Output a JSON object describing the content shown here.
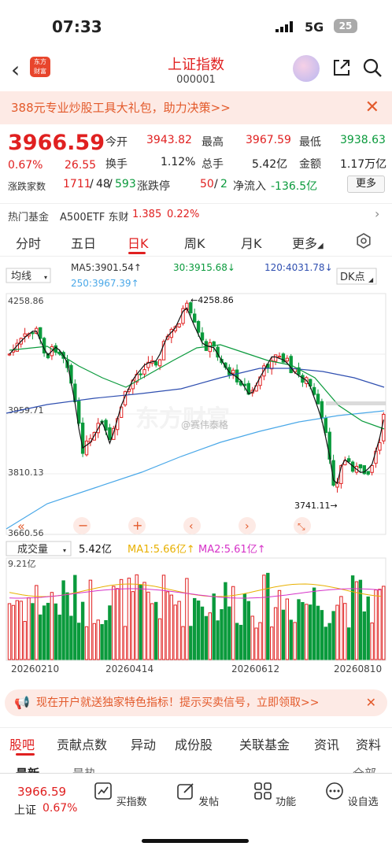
{
  "status": {
    "time": "07:33",
    "network": "5G",
    "battery": "25"
  },
  "header": {
    "title": "上证指数",
    "code": "000001",
    "logo_text": "东方财富"
  },
  "banner": {
    "text": "388元专业炒股工具大礼包，助力决策>>"
  },
  "quote": {
    "price": "3966.59",
    "change_pct": "0.67%",
    "change": "26.55",
    "open_label": "今开",
    "open": "3943.82",
    "high_label": "最高",
    "high": "3967.59",
    "low_label": "最低",
    "low": "3938.63",
    "turnover_label": "换手",
    "turnover": "1.12%",
    "volume_label": "总手",
    "volume": "5.42亿",
    "amount_label": "金额",
    "amount": "1.17万亿",
    "breadth_label": "涨跌家数",
    "up": "1711",
    "flat": "48",
    "down": "593",
    "limit_label": "涨跌停",
    "limit_up": "50",
    "limit_down": "2",
    "inflow_label": "净流入",
    "inflow": "-136.5亿",
    "more": "更多"
  },
  "fund": {
    "label": "热门基金",
    "name": "A500ETF 东财",
    "price": "1.385",
    "pct": "0.22%"
  },
  "tabs": [
    "分时",
    "五日",
    "日K",
    "周K",
    "月K",
    "更多"
  ],
  "chart": {
    "ma_select": "均线",
    "ma5": "MA5:3901.54↑",
    "ma30": "30:3915.68↓",
    "ma120": "120:4031.78↓",
    "ma250": "250:3967.39↑",
    "dk": "DK点",
    "y_high": "4258.86",
    "y_mid": "3959.71",
    "y_low2": "3810.13",
    "y_low": "3660.56",
    "marker_high": "4258.86",
    "marker_low": "3741.11",
    "vol_select": "成交量",
    "vol_value": "5.42亿",
    "vol_ma1": "MA1:5.66亿↑",
    "vol_ma2": "MA2:5.61亿↑",
    "vol_max": "9.21亿",
    "dates": [
      "20260210",
      "20260414",
      "20260612",
      "20260810"
    ],
    "watermark": "东方财富",
    "watermark2": "@赛伟泰格"
  },
  "ad": {
    "text": "现在开户就送独家特色指标！提示买卖信号，立即领取>>"
  },
  "subtabs": [
    "股吧",
    "贡献点数",
    "异动",
    "成份股",
    "关联基金",
    "资讯",
    "资料"
  ],
  "subrow": {
    "latest": "最新",
    "hot": "最热",
    "all": "全部"
  },
  "bottom": {
    "price": "3966.59",
    "name": "上证",
    "pct": "0.67%",
    "items": [
      "买指数",
      "发帖",
      "功能",
      "设自选"
    ]
  },
  "colors": {
    "up": "#e02020",
    "down": "#0a9a3c",
    "accent": "#e35a2b"
  }
}
